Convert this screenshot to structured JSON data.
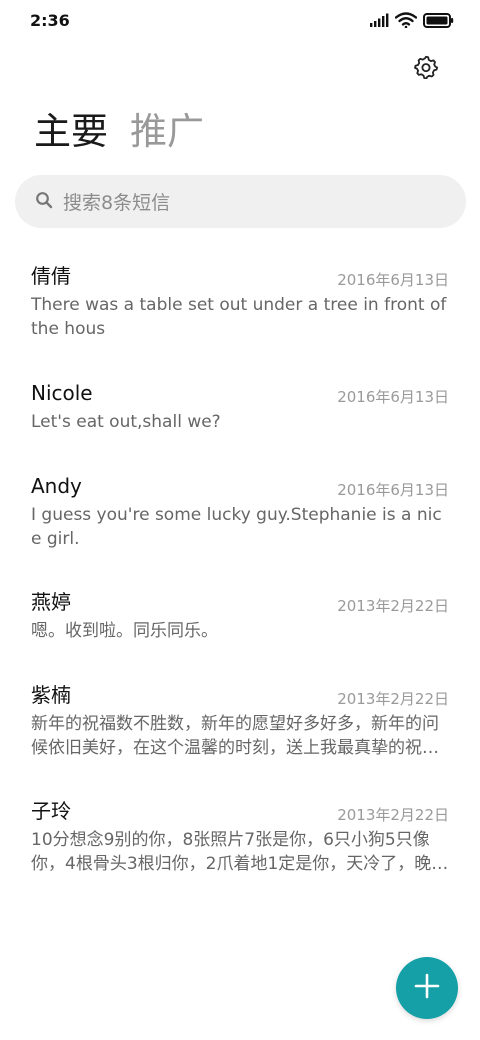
{
  "status_bar": {
    "time": "2:36",
    "icons": [
      "signal-icon",
      "wifi-icon",
      "battery-icon"
    ]
  },
  "header": {
    "settings_icon": "gear-icon",
    "tabs": [
      {
        "label": "主要",
        "active": true
      },
      {
        "label": "推广",
        "active": false
      }
    ]
  },
  "search": {
    "placeholder": "搜索8条短信",
    "icon": "search-icon"
  },
  "conversations": [
    {
      "name": "倩倩",
      "date": "2016年6月13日",
      "message": "There was a table set out under a tree in front of the hous"
    },
    {
      "name": "Nicole",
      "date": "2016年6月13日",
      "message": "Let's eat out,shall we?"
    },
    {
      "name": "Andy",
      "date": "2016年6月13日",
      "message": "I guess you're some lucky guy.Stephanie is a nice girl."
    },
    {
      "name": "燕婷",
      "date": "2013年2月22日",
      "message": "嗯。收到啦。同乐同乐。"
    },
    {
      "name": "紫楠",
      "date": "2013年2月22日",
      "message": "新年的祝福数不胜数，新年的愿望好多好多，新年的问候依旧美好，在这个温馨的时刻，送上我最真挚的祝…"
    },
    {
      "name": "子玲",
      "date": "2013年2月22日",
      "message": "10分想念9别的你，8张照片7张是你，6只小狗5只像你，4根骨头3根归你，2爪着地1定是你，天冷了，晚…"
    }
  ],
  "fab": {
    "icon": "plus-icon",
    "color": "#14a0a6"
  },
  "colors": {
    "accent": "#14a0a6",
    "inactive_tab": "#999999",
    "search_bg": "#f0f0f0"
  }
}
